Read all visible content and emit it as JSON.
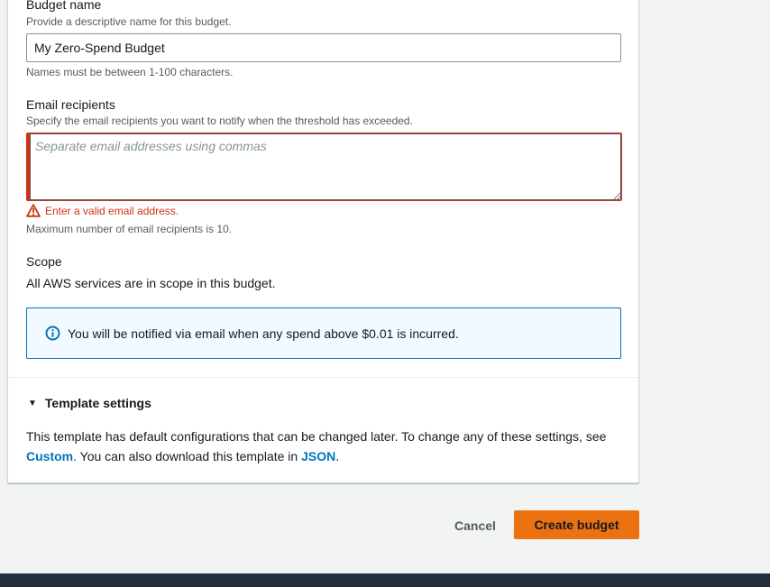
{
  "budget_name": {
    "label": "Budget name",
    "description": "Provide a descriptive name for this budget.",
    "value": "My Zero-Spend Budget",
    "constraint": "Names must be between 1-100 characters."
  },
  "email_recipients": {
    "label": "Email recipients",
    "description": "Specify the email recipients you want to notify when the threshold has exceeded.",
    "placeholder": "Separate email addresses using commas",
    "value": "",
    "error": "Enter a valid email address.",
    "constraint": "Maximum number of email recipients is 10."
  },
  "scope": {
    "label": "Scope",
    "text": "All AWS services are in scope in this budget."
  },
  "info_alert": {
    "text": "You will be notified via email when any spend above $0.01 is incurred."
  },
  "template_settings": {
    "title": "Template settings",
    "expanded": true,
    "text_before": "This template has default configurations that can be changed later. To change any of these settings, see ",
    "custom_link": "Custom",
    "text_middle": ". You can also download this template in ",
    "json_link": "JSON",
    "text_after": "."
  },
  "actions": {
    "cancel_label": "Cancel",
    "create_label": "Create budget"
  },
  "icons": {
    "error": "warning-triangle-icon",
    "info": "info-circle-icon",
    "expand": "caret-down-icon"
  },
  "colors": {
    "primary_button": "#ec7211",
    "error": "#d13212",
    "link": "#0073bb",
    "info_bg": "#f1faff",
    "footer": "#232f3e"
  }
}
